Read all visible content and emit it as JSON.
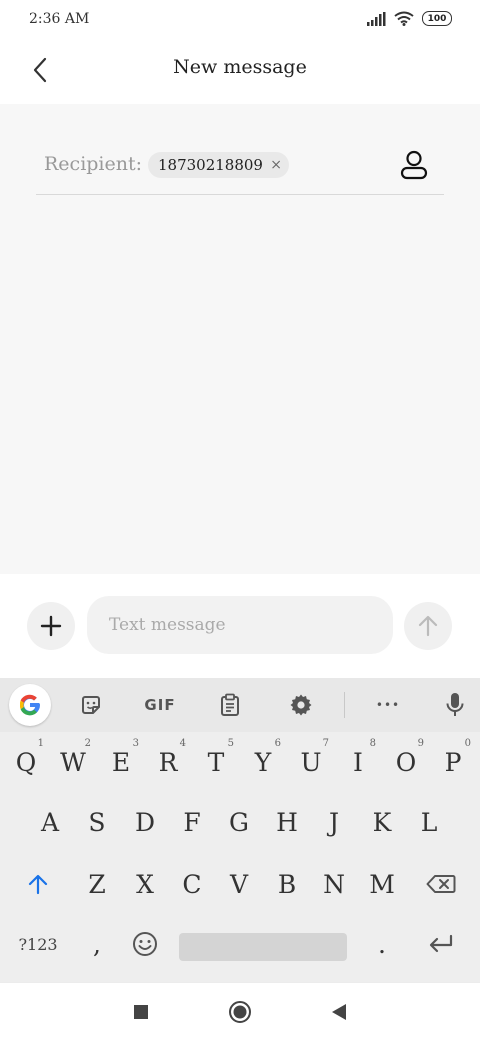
{
  "status_bar": {
    "time": "2:36 AM",
    "battery": "100"
  },
  "header": {
    "title": "New message"
  },
  "recipient": {
    "label": "Recipient:",
    "chips": [
      "18730218809"
    ],
    "remove_glyph": "×"
  },
  "compose": {
    "placeholder": "Text message"
  },
  "keyboard": {
    "toolbar": {
      "gif_label": "GIF",
      "more_label": "•••"
    },
    "rows": [
      [
        {
          "key": "Q",
          "hint": "1"
        },
        {
          "key": "W",
          "hint": "2"
        },
        {
          "key": "E",
          "hint": "3"
        },
        {
          "key": "R",
          "hint": "4"
        },
        {
          "key": "T",
          "hint": "5"
        },
        {
          "key": "Y",
          "hint": "6"
        },
        {
          "key": "U",
          "hint": "7"
        },
        {
          "key": "I",
          "hint": "8"
        },
        {
          "key": "O",
          "hint": "9"
        },
        {
          "key": "P",
          "hint": "0"
        }
      ],
      [
        {
          "key": "A"
        },
        {
          "key": "S"
        },
        {
          "key": "D"
        },
        {
          "key": "F"
        },
        {
          "key": "G"
        },
        {
          "key": "H"
        },
        {
          "key": "J"
        },
        {
          "key": "K"
        },
        {
          "key": "L"
        }
      ],
      [
        {
          "key": "Z"
        },
        {
          "key": "X"
        },
        {
          "key": "C"
        },
        {
          "key": "V"
        },
        {
          "key": "B"
        },
        {
          "key": "N"
        },
        {
          "key": "M"
        }
      ]
    ],
    "symbols_label": "?123",
    "comma_label": ",",
    "period_label": "."
  },
  "icons": [
    "signal-icon",
    "wifi-icon",
    "battery-icon",
    "back-arrow-icon",
    "contact-icon",
    "add-icon",
    "send-icon",
    "google-icon",
    "sticker-icon",
    "clipboard-icon",
    "gear-icon",
    "mic-icon",
    "shift-icon",
    "backspace-icon",
    "emoji-icon",
    "enter-icon",
    "recents-icon",
    "home-icon",
    "back-nav-icon"
  ],
  "colors": {
    "shift_accent": "#1a73e8",
    "google_blue": "#4285F4",
    "google_red": "#EA4335",
    "google_yellow": "#FBBC05",
    "google_green": "#34A853"
  }
}
